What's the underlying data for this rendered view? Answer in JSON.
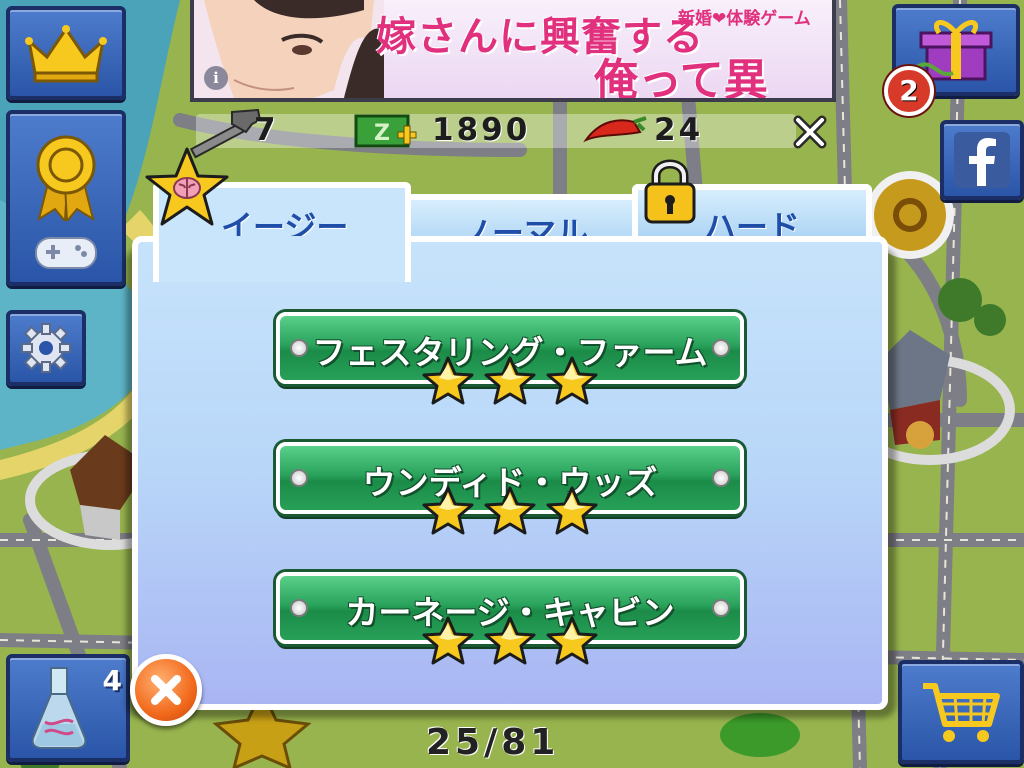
{
  "ad": {
    "headline": "嫁さんに興奮する",
    "tagline": "新婚❤体験ゲーム",
    "subline": "俺って異常？",
    "info_icon": "i"
  },
  "resources": {
    "hammers": "7",
    "cash": "1890",
    "peppers": "24"
  },
  "badges": {
    "gift_count": "2",
    "flask_count": "4"
  },
  "tabs": [
    {
      "label": "イージー",
      "active": true
    },
    {
      "label": "ノーマル",
      "active": false
    },
    {
      "label": "ハード",
      "active": false,
      "locked": true
    }
  ],
  "levels": [
    {
      "name": "フェスタリング・ファーム",
      "stars": 3
    },
    {
      "name": "ウンディド・ウッズ",
      "stars": 3
    },
    {
      "name": "カーネージ・キャビン",
      "stars": 3
    }
  ],
  "progress": "25/81",
  "icons": [
    "crown-icon",
    "award-ribbon-icon",
    "gamepad-icon",
    "gear-icon",
    "flask-icon",
    "gift-icon",
    "facebook-icon",
    "cart-icon",
    "hammer-icon",
    "cash-icon",
    "chili-pepper-icon",
    "close-icon",
    "padlock-icon",
    "star-brain-icon"
  ],
  "colors": {
    "tab_text": "#1f4ea8",
    "level_button": "#2aa35c",
    "star": "#f7c81e",
    "close_button": "#f26a1c",
    "ad_text": "#e0307e",
    "side_button": "#2a55a8"
  }
}
